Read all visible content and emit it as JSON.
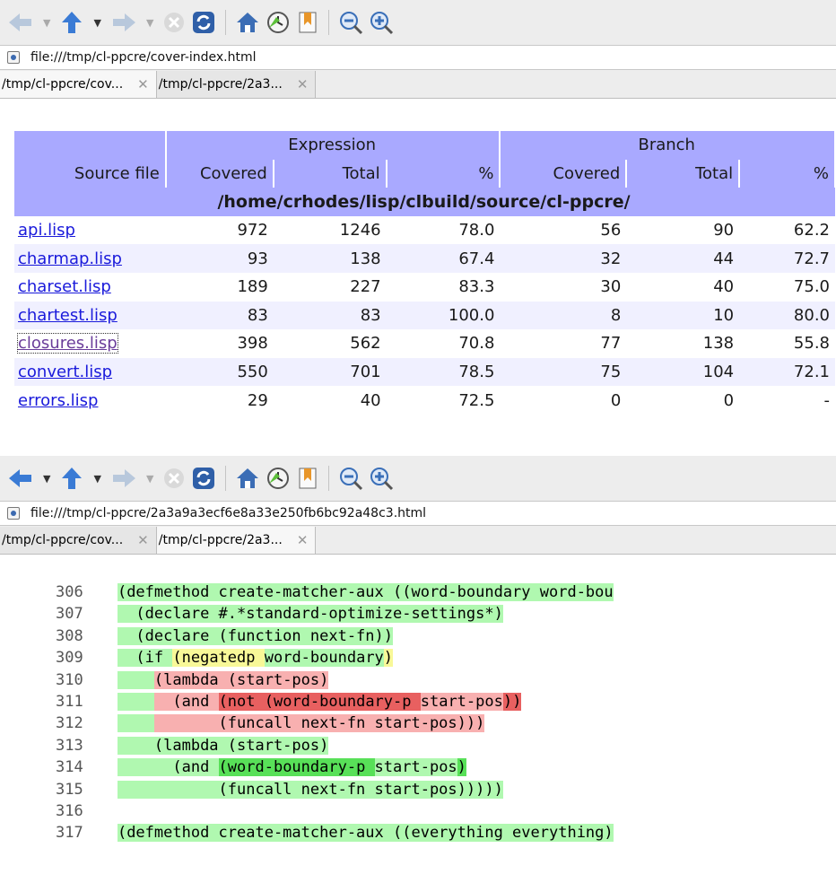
{
  "browser_top": {
    "url": "file:///tmp/cl-ppcre/cover-index.html",
    "tabs": [
      {
        "label": "/tmp/cl-ppcre/cov...",
        "active": true
      },
      {
        "label": "/tmp/cl-ppcre/2a3...",
        "active": false
      }
    ]
  },
  "browser_bottom": {
    "url": "file:///tmp/cl-ppcre/2a3a9a3ecf6e8a33e250fb6bc92a48c3.html",
    "tabs": [
      {
        "label": "/tmp/cl-ppcre/cov...",
        "active": false
      },
      {
        "label": "/tmp/cl-ppcre/2a3...",
        "active": true
      }
    ]
  },
  "toolbar": {
    "buttons": [
      "back-icon",
      "up-icon",
      "forward-icon",
      "stop-icon",
      "reload-icon",
      "home-icon",
      "history-icon",
      "bookmark-icon",
      "zoom-out-icon",
      "zoom-in-icon"
    ]
  },
  "coverage_table": {
    "group_headers": [
      "",
      "Expression",
      "Branch"
    ],
    "columns": [
      "Source file",
      "Covered",
      "Total",
      "%",
      "Covered",
      "Total",
      "%"
    ],
    "directory": "/home/crhodes/lisp/clbuild/source/cl-ppcre/",
    "rows": [
      {
        "file": "api.lisp",
        "e_cov": "972",
        "e_tot": "1246",
        "e_pct": "78.0",
        "b_cov": "56",
        "b_tot": "90",
        "b_pct": "62.2"
      },
      {
        "file": "charmap.lisp",
        "e_cov": "93",
        "e_tot": "138",
        "e_pct": "67.4",
        "b_cov": "32",
        "b_tot": "44",
        "b_pct": "72.7"
      },
      {
        "file": "charset.lisp",
        "e_cov": "189",
        "e_tot": "227",
        "e_pct": "83.3",
        "b_cov": "30",
        "b_tot": "40",
        "b_pct": "75.0"
      },
      {
        "file": "chartest.lisp",
        "e_cov": "83",
        "e_tot": "83",
        "e_pct": "100.0",
        "b_cov": "8",
        "b_tot": "10",
        "b_pct": "80.0"
      },
      {
        "file": "closures.lisp",
        "e_cov": "398",
        "e_tot": "562",
        "e_pct": "70.8",
        "b_cov": "77",
        "b_tot": "138",
        "b_pct": "55.8"
      },
      {
        "file": "convert.lisp",
        "e_cov": "550",
        "e_tot": "701",
        "e_pct": "78.5",
        "b_cov": "75",
        "b_tot": "104",
        "b_pct": "72.1"
      },
      {
        "file": "errors.lisp",
        "e_cov": "29",
        "e_tot": "40",
        "e_pct": "72.5",
        "b_cov": "0",
        "b_tot": "0",
        "b_pct": "-"
      }
    ]
  },
  "coverage_colors": {
    "covered": "#b0f8b0",
    "covered_strong": "#58e058",
    "partial": "#f8f898",
    "not_covered": "#f8b0b0",
    "not_covered_strong": "#e86060",
    "header": "#a9a9ff"
  },
  "code": {
    "partial_top_line": "305",
    "lines": [
      {
        "num": "306",
        "segs": [
          {
            "t": "    "
          },
          {
            "t": "(defmethod create-matcher-aux ((word-boundary word-bou",
            "c": "g1"
          }
        ]
      },
      {
        "num": "307",
        "segs": [
          {
            "t": "    "
          },
          {
            "t": "  (declare #.*standard-optimize-settings*)",
            "c": "g1"
          }
        ]
      },
      {
        "num": "308",
        "segs": [
          {
            "t": "    "
          },
          {
            "t": "  (declare (function next-fn))",
            "c": "g1"
          }
        ]
      },
      {
        "num": "309",
        "segs": [
          {
            "t": "    "
          },
          {
            "t": "  (if ",
            "c": "g1"
          },
          {
            "t": "(negatedp ",
            "c": "y"
          },
          {
            "t": "word-boundary",
            "c": "g1"
          },
          {
            "t": ")",
            "c": "y"
          }
        ]
      },
      {
        "num": "310",
        "segs": [
          {
            "t": "    "
          },
          {
            "t": "    ",
            "c": "g1"
          },
          {
            "t": "(lambda (start-pos)",
            "c": "r1"
          }
        ]
      },
      {
        "num": "311",
        "segs": [
          {
            "t": "    "
          },
          {
            "t": "    ",
            "c": "g1"
          },
          {
            "t": "  (and ",
            "c": "r1"
          },
          {
            "t": "(not (word-boundary-p ",
            "c": "r2"
          },
          {
            "t": "start-pos",
            "c": "r1"
          },
          {
            "t": "))",
            "c": "r2"
          }
        ]
      },
      {
        "num": "312",
        "segs": [
          {
            "t": "    "
          },
          {
            "t": "    ",
            "c": "g1"
          },
          {
            "t": "       (funcall next-fn start-pos)))",
            "c": "r1"
          }
        ]
      },
      {
        "num": "313",
        "segs": [
          {
            "t": "    "
          },
          {
            "t": "    (lambda (start-pos)",
            "c": "g1"
          }
        ]
      },
      {
        "num": "314",
        "segs": [
          {
            "t": "    "
          },
          {
            "t": "      (and ",
            "c": "g1"
          },
          {
            "t": "(word-boundary-p ",
            "c": "g2"
          },
          {
            "t": "start-pos",
            "c": "g1"
          },
          {
            "t": ")",
            "c": "g2"
          }
        ]
      },
      {
        "num": "315",
        "segs": [
          {
            "t": "    "
          },
          {
            "t": "           (funcall next-fn start-pos)))))",
            "c": "g1"
          }
        ]
      },
      {
        "num": "316",
        "segs": []
      },
      {
        "num": "317",
        "segs": [
          {
            "t": "    "
          },
          {
            "t": "(defmethod create-matcher-aux ((everything everything)",
            "c": "g1"
          }
        ]
      }
    ]
  }
}
